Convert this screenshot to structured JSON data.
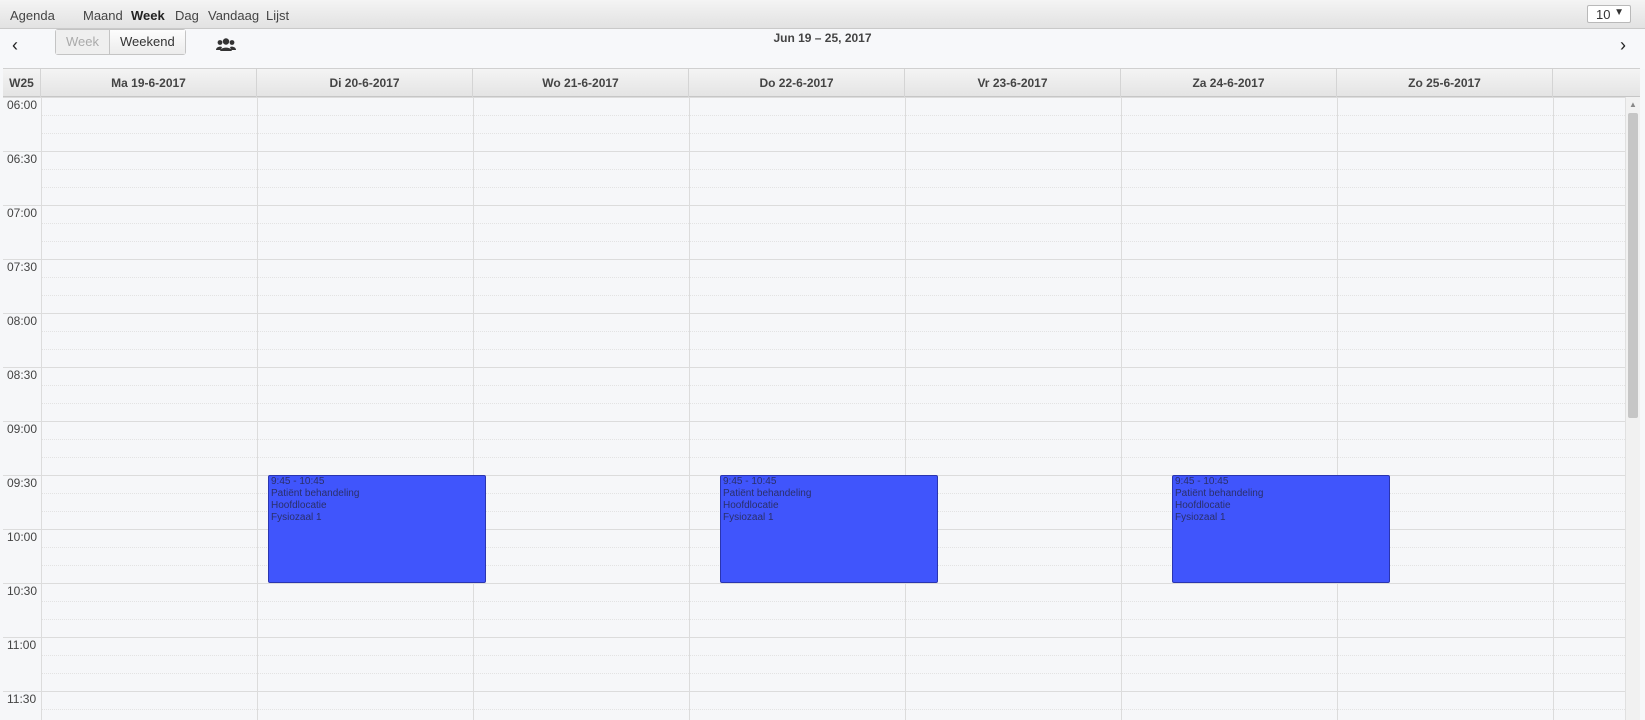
{
  "topbar": {
    "app_title": "Agenda",
    "views": [
      {
        "label": "Maand",
        "active": false
      },
      {
        "label": "Week",
        "active": true
      },
      {
        "label": "Dag",
        "active": false
      },
      {
        "label": "Vandaag",
        "active": false
      },
      {
        "label": "Lijst",
        "active": false
      }
    ],
    "count_select": "10"
  },
  "toolbar": {
    "prev_icon": "chevron-left-icon",
    "next_icon": "chevron-right-icon",
    "week_button": "Week",
    "weekend_button": "Weekend",
    "users_icon": "users-icon",
    "date_range": "Jun 19 – 25, 2017"
  },
  "calendar": {
    "week_label": "W25",
    "days": [
      "Ma 19-6-2017",
      "Di 20-6-2017",
      "Wo 21-6-2017",
      "Do 22-6-2017",
      "Vr 23-6-2017",
      "Za 24-6-2017",
      "Zo 25-6-2017"
    ],
    "times": [
      "06:00",
      "06:30",
      "07:00",
      "07:30",
      "08:00",
      "08:30",
      "09:00",
      "09:30",
      "10:00",
      "10:30",
      "11:00",
      "11:30"
    ],
    "event_color": "#4055fc",
    "events": [
      {
        "day": 1,
        "time": "9:45 - 10:45",
        "title": "Patiënt behandeling",
        "location": "Hoofdlocatie",
        "room": "Fysiozaal 1"
      },
      {
        "day": 3,
        "time": "9:45 - 10:45",
        "title": "Patiënt behandeling",
        "location": "Hoofdlocatie",
        "room": "Fysiozaal 1"
      },
      {
        "day": 5,
        "time": "9:45 - 10:45",
        "title": "Patiënt behandeling",
        "location": "Hoofdlocatie",
        "room": "Fysiozaal 1"
      }
    ]
  }
}
